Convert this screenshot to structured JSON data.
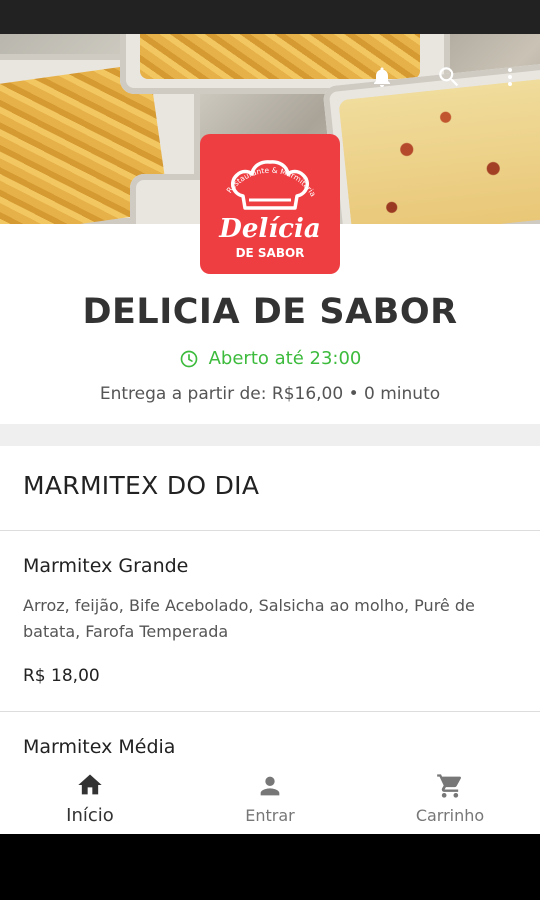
{
  "store": {
    "name": "DELICIA DE SABOR",
    "open_status": "Aberto até 23:00",
    "delivery_info": "Entrega a partir de: R$16,00 • 0 minuto"
  },
  "logo": {
    "arc_text": "Restaurante & Marmitaria",
    "script_text": "Delícia",
    "sub_text": "DE SABOR"
  },
  "header_icons": [
    "bell-icon",
    "search-icon",
    "more-vert-icon"
  ],
  "menu": {
    "section_title": "MARMITEX DO DIA",
    "items": [
      {
        "name": "Marmitex Grande",
        "description": "Arroz, feijão, Bife Acebolado, Salsicha ao molho, Purê de batata, Farofa Temperada",
        "price": "R$ 18,00"
      },
      {
        "name": "Marmitex Média"
      }
    ]
  },
  "bottom_nav": [
    {
      "label": "Início",
      "icon": "home-icon",
      "active": true
    },
    {
      "label": "Entrar",
      "icon": "person-icon",
      "active": false
    },
    {
      "label": "Carrinho",
      "icon": "cart-icon",
      "active": false
    }
  ],
  "colors": {
    "brand_red": "#ef3e42",
    "open_green": "#3dbb3d"
  }
}
